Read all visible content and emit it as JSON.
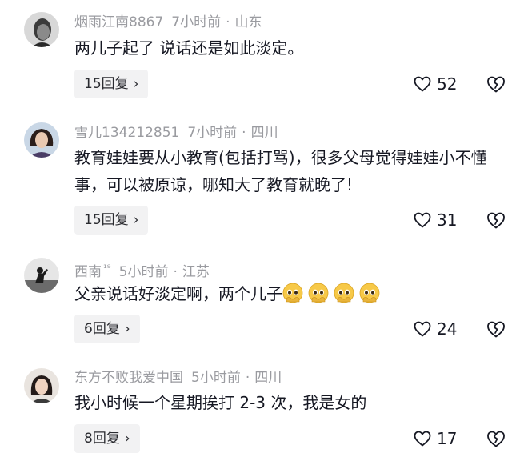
{
  "comments": [
    {
      "user": "烟雨江南8867",
      "time": "7小时前",
      "sep": "·",
      "location": "山东",
      "text": "两儿子起了 说话还是如此淡定。",
      "replies": "15回复",
      "chevron": "›",
      "likes": "52",
      "avatar": "man-portrait"
    },
    {
      "user": "雪儿134212851",
      "time": "7小时前",
      "sep": "·",
      "location": "四川",
      "text": "教育娃娃要从小教育(包括打骂)，很多父母觉得娃娃小不懂事，可以被原谅，哪知大了教育就晚了!",
      "replies": "15回复",
      "chevron": "›",
      "likes": "31",
      "avatar": "woman-portrait"
    },
    {
      "user": "西南",
      "badge": "¹⁹",
      "time": "5小时前",
      "sep": "·",
      "location": "江苏",
      "text": "父亲说话好淡定啊，两个儿子",
      "emojis": [
        "pleading-face-icon",
        "pleading-face-icon",
        "pleading-face-icon",
        "pleading-face-icon"
      ],
      "replies": "6回复",
      "chevron": "›",
      "likes": "24",
      "avatar": "silhouette"
    },
    {
      "user": "东方不败我爱中国",
      "time": "5小时前",
      "sep": "·",
      "location": "四川",
      "text": "我小时候一个星期挨打 2-3 次，我是女的",
      "replies": "8回复",
      "chevron": "›",
      "likes": "17",
      "avatar": "woman-portrait"
    }
  ],
  "colors": {
    "meta": "#9a9ba0",
    "text": "#161823",
    "reply_bg": "#f2f2f3"
  }
}
